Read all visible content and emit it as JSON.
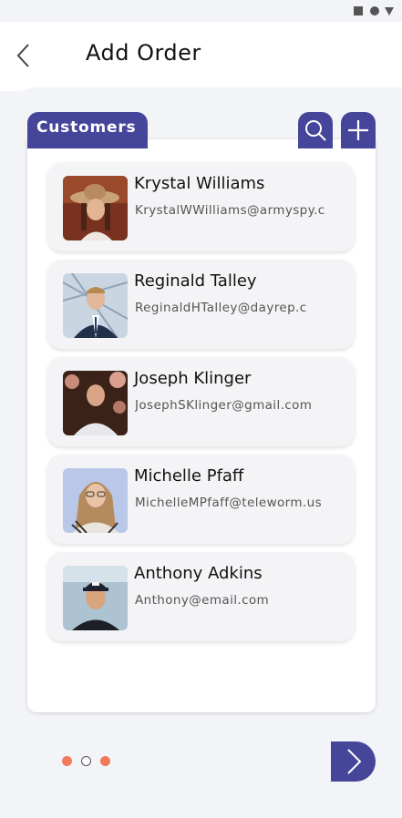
{
  "header": {
    "title": "Add Order"
  },
  "tab": {
    "label": "Customers"
  },
  "customers": [
    {
      "name": "Krystal Williams",
      "email": "KrystalWWilliams@armyspy.c"
    },
    {
      "name": "Reginald Talley",
      "email": "ReginaldHTalley@dayrep.c"
    },
    {
      "name": "Joseph Klinger",
      "email": "JosephSKlinger@gmail.com"
    },
    {
      "name": "Michelle Pfaff",
      "email": "MichelleMPfaff@teleworm.us"
    },
    {
      "name": "Anthony Adkins",
      "email": "Anthony@email.com"
    }
  ],
  "pagination": {
    "total": 3,
    "active": [
      1,
      3
    ]
  },
  "colors": {
    "accent": "#45459a",
    "dot": "#f07a5a",
    "background": "#f3f4f8"
  },
  "icons": [
    "back-icon",
    "search-icon",
    "plus-icon",
    "next-arrow-icon"
  ]
}
